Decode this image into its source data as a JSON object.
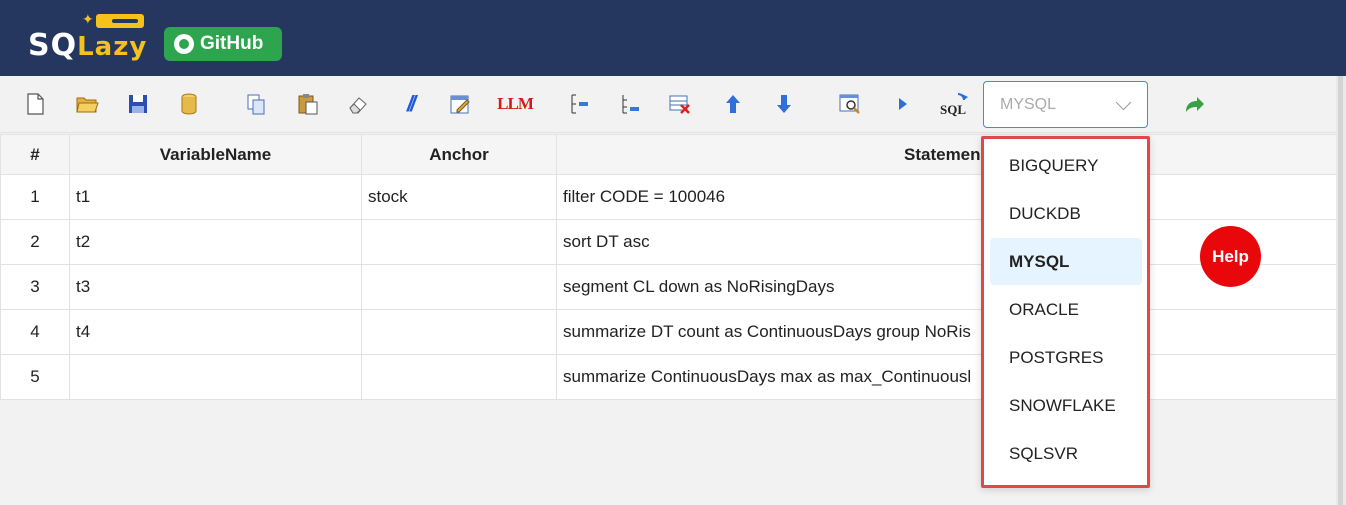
{
  "header": {
    "logo_sq": "SQ",
    "logo_lazy": "Lazy",
    "github_label": "GitHub"
  },
  "toolbar": {
    "icons": [
      "new-file-icon",
      "open-folder-icon",
      "save-icon",
      "database-icon",
      "copy-icon",
      "paste-icon",
      "eraser-icon",
      "comment-icon",
      "edit-form-icon",
      "llm-icon",
      "insert-row-icon",
      "append-row-icon",
      "delete-row-icon",
      "move-up-icon",
      "move-down-icon",
      "preview-icon",
      "run-icon",
      "sql-icon",
      "redo-icon"
    ],
    "llm_label": "LLM",
    "comment_label": "//",
    "sql_label": "SQL"
  },
  "dialect_select": {
    "value": "MYSQL",
    "options": [
      "BIGQUERY",
      "DUCKDB",
      "MYSQL",
      "ORACLE",
      "POSTGRES",
      "SNOWFLAKE",
      "SQLSVR"
    ]
  },
  "grid": {
    "columns": [
      "#",
      "VariableName",
      "Anchor",
      "Statemen"
    ],
    "rows": [
      {
        "num": "1",
        "var": "t1",
        "anchor": "stock",
        "stmt": "filter CODE = 100046"
      },
      {
        "num": "2",
        "var": "t2",
        "anchor": "",
        "stmt": "sort DT asc"
      },
      {
        "num": "3",
        "var": "t3",
        "anchor": "",
        "stmt": "segment CL down as NoRisingDays"
      },
      {
        "num": "4",
        "var": "t4",
        "anchor": "",
        "stmt": "summarize DT count as ContinuousDays group NoRis"
      },
      {
        "num": "5",
        "var": "",
        "anchor": "",
        "stmt": "summarize ContinuousDays max as max_Continuousl"
      }
    ]
  },
  "help_label": "Help",
  "colors": {
    "header_bg": "#25375f",
    "accent": "#3d8de0",
    "help": "#e8080c",
    "github": "#2da44e"
  }
}
